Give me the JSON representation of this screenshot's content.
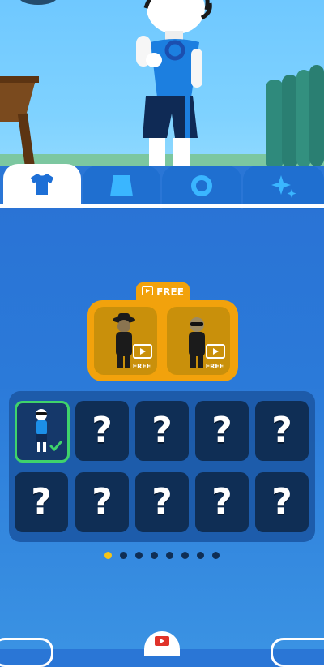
{
  "tabs": [
    {
      "icon": "shirt-icon",
      "active": true
    },
    {
      "icon": "shorts-icon",
      "active": false
    },
    {
      "icon": "ring-icon",
      "active": false
    },
    {
      "icon": "sparkle-icon",
      "active": false
    }
  ],
  "free_offer": {
    "header_label": "FREE",
    "items": [
      {
        "outfit": "detective-hat-suit",
        "badge": "FREE"
      },
      {
        "outfit": "sunglasses-suit",
        "badge": "FREE"
      }
    ]
  },
  "grid": {
    "rows": [
      [
        "selected",
        "?",
        "?",
        "?",
        "?"
      ],
      [
        "?",
        "?",
        "?",
        "?",
        "?"
      ]
    ]
  },
  "pagination": {
    "count": 8,
    "active_index": 0
  },
  "colors": {
    "accent": "#f2a20c",
    "panel": "#2a73d5",
    "cell": "#0f2e55",
    "selected_border": "#3fd36b",
    "active_dot": "#f5c518"
  }
}
